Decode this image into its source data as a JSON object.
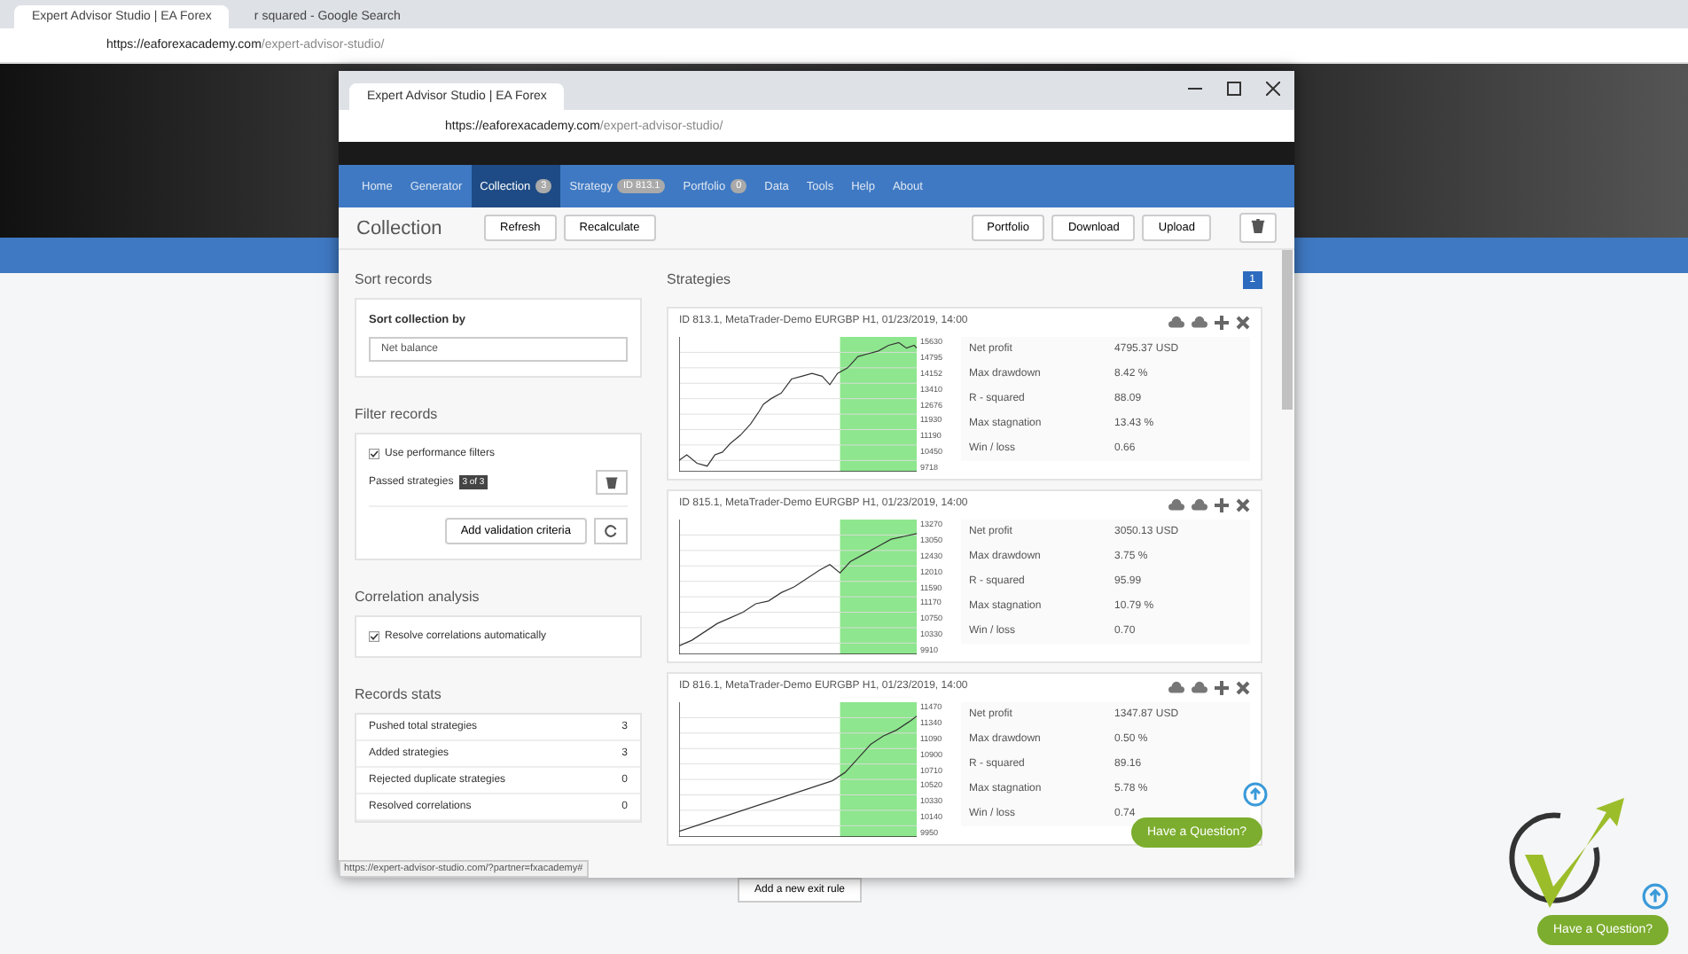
{
  "outer_browser": {
    "tabs": [
      {
        "title": "Expert Advisor Studio | EA Forex",
        "selected": true
      },
      {
        "title": "r squared - Google Search",
        "selected": false
      }
    ],
    "url_host": "https://eaforexacademy.com",
    "url_path": "/expert-advisor-studio/"
  },
  "page_button": "Add a new exit rule",
  "page_help_button": "Have a Question?",
  "window": {
    "tab_title": "Expert Advisor Studio | EA Forex",
    "url_host": "https://eaforexacademy.com",
    "url_path": "/expert-advisor-studio/",
    "nav": [
      {
        "label": "Home",
        "selected": false
      },
      {
        "label": "Generator",
        "selected": false
      },
      {
        "label": "Collection",
        "badge": "3",
        "selected": true
      },
      {
        "label": "Strategy",
        "badge": "ID 813.1",
        "selected": false
      },
      {
        "label": "Portfolio",
        "badge": "0",
        "selected": false
      },
      {
        "label": "Data",
        "selected": false
      },
      {
        "label": "Tools",
        "selected": false
      },
      {
        "label": "Help",
        "selected": false
      },
      {
        "label": "About",
        "selected": false
      }
    ],
    "title": "Collection",
    "toolbar_left": [
      "Refresh",
      "Recalculate"
    ],
    "toolbar_right": [
      "Portfolio",
      "Download",
      "Upload"
    ],
    "sort": {
      "heading": "Sort records",
      "label": "Sort collection by",
      "value": "Net balance"
    },
    "filter": {
      "heading": "Filter records",
      "checkbox": {
        "label": "Use performance filters",
        "checked": true
      },
      "passed_label": "Passed strategies",
      "passed_badge": "3 of 3",
      "button": "Add validation criteria"
    },
    "correlation": {
      "heading": "Correlation analysis",
      "checkbox": {
        "label": "Resolve correlations automatically",
        "checked": true
      }
    },
    "stats": {
      "heading": "Records stats",
      "rows": [
        {
          "label": "Pushed total strategies",
          "value": "3"
        },
        {
          "label": "Added strategies",
          "value": "3"
        },
        {
          "label": "Rejected duplicate strategies",
          "value": "0"
        },
        {
          "label": "Resolved correlations",
          "value": "0"
        }
      ]
    },
    "status_url": "https://expert-advisor-studio.com/?partner=fxacademy#",
    "strategies": {
      "heading": "Strategies",
      "page": "1",
      "cards": [
        {
          "title": "ID 813.1, MetaTrader-Demo EURGBP H1, 01/23/2019, 14:00",
          "scale": [
            "15630",
            "14795",
            "14152",
            "13410",
            "12676",
            "11930",
            "11190",
            "10450",
            "9718"
          ],
          "stats": [
            {
              "label": "Net profit",
              "value": "4795.37 USD"
            },
            {
              "label": "Max drawdown",
              "value": "8.42 %"
            },
            {
              "label": "R - squared",
              "value": "88.09"
            },
            {
              "label": "Max stagnation",
              "value": "13.43 %"
            },
            {
              "label": "Win / loss",
              "value": "0.66"
            }
          ]
        },
        {
          "title": "ID 815.1, MetaTrader-Demo EURGBP H1, 01/23/2019, 14:00",
          "scale": [
            "13270",
            "13050",
            "12430",
            "12010",
            "11590",
            "11170",
            "10750",
            "10330",
            "9910"
          ],
          "stats": [
            {
              "label": "Net profit",
              "value": "3050.13 USD"
            },
            {
              "label": "Max drawdown",
              "value": "3.75 %"
            },
            {
              "label": "R - squared",
              "value": "95.99"
            },
            {
              "label": "Max stagnation",
              "value": "10.79 %"
            },
            {
              "label": "Win / loss",
              "value": "0.70"
            }
          ]
        },
        {
          "title": "ID 816.1, MetaTrader-Demo EURGBP H1, 01/23/2019, 14:00",
          "scale": [
            "11470",
            "11340",
            "11090",
            "10900",
            "10710",
            "10520",
            "10330",
            "10140",
            "9950"
          ],
          "stats": [
            {
              "label": "Net profit",
              "value": "1347.87 USD"
            },
            {
              "label": "Max drawdown",
              "value": "0.50 %"
            },
            {
              "label": "R - squared",
              "value": "89.16"
            },
            {
              "label": "Max stagnation",
              "value": "5.78 %"
            },
            {
              "label": "Win / loss",
              "value": "0.74"
            }
          ]
        }
      ]
    },
    "help_button": "Have a Question?"
  }
}
